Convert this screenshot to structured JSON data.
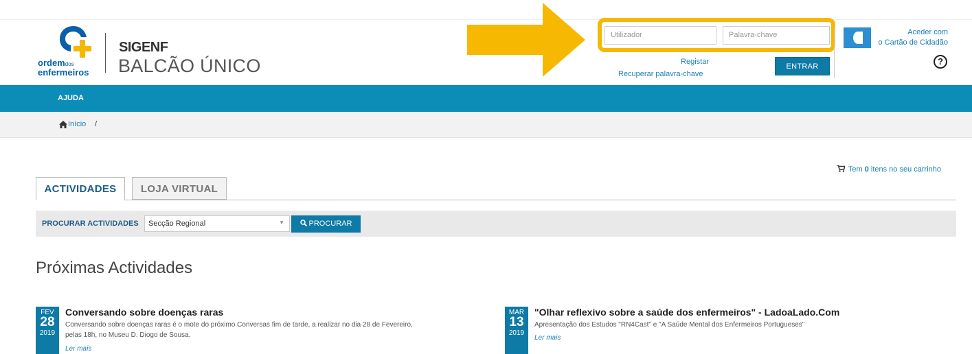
{
  "logo": {
    "line1": "ordem",
    "line1_small": "dos",
    "line2": "enfermeiros"
  },
  "brand": {
    "title": "SIGENF",
    "subtitle": "BALCÃO ÚNICO"
  },
  "login": {
    "user_placeholder": "Utilizador",
    "password_placeholder": "Palavra-chave",
    "register_label": "Registar",
    "recover_label": "Recuperar palavra-chave",
    "enter_label": "ENTRAR"
  },
  "citizen_card": {
    "line1": "Aceder com",
    "line2": "o Cartão de Cidadão"
  },
  "help": {
    "symbol": "?"
  },
  "nav": {
    "items": [
      {
        "label": "AJUDA"
      }
    ]
  },
  "breadcrumb": {
    "home_label": "Início",
    "separator": "/"
  },
  "cart": {
    "prefix": "Tem",
    "count": "0",
    "suffix": "itens no seu carrinho"
  },
  "tabs": [
    {
      "label": "ACTIVIDADES",
      "active": true
    },
    {
      "label": "LOJA VIRTUAL",
      "active": false
    }
  ],
  "search": {
    "label": "PROCURAR ACTIVIDADES",
    "select_value": "Secção Regional",
    "button_label": "PROCURAR"
  },
  "section": {
    "title": "Próximas Actividades"
  },
  "events": [
    {
      "month": "FEV",
      "day": "28",
      "year": "2019",
      "title": "Conversando sobre doenças raras",
      "desc_line1": "Conversando sobre doenças raras é o mote do próximo Conversas fim de tarde, a realizar no dia 28 de Fevereiro,",
      "desc_line2": "pelas 18h, no Museu D. Diogo de Sousa.",
      "more": "Ler mais"
    },
    {
      "month": "MAR",
      "day": "13",
      "year": "2019",
      "title": "\"Olhar reflexivo sobre a saúde dos enfermeiros\" - LadoaLado.Com",
      "desc_line1": "Apresentação dos Estudos \"RN4Cast\" e \"A Saúde Mental dos Enfermeiros Portugueses\"",
      "more": "Ler mais"
    }
  ],
  "colors": {
    "primary": "#0c8db8",
    "button": "#0e7aa6",
    "highlight": "#f6b800",
    "logo_yellow": "#f5b800",
    "logo_blue": "#0a5fa8"
  }
}
